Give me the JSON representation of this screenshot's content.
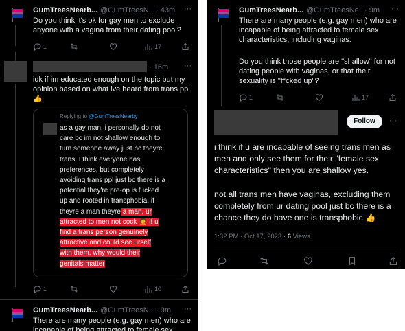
{
  "left": {
    "tweet1": {
      "name": "GumTreesNearb...",
      "handle": "@GumTreesN...",
      "time": "· 43m",
      "more": "···",
      "text": "Do you think it's ok for gay men to exclude anyone with a vagina from their dating pool?",
      "replies": "1",
      "views": "17"
    },
    "tweet2": {
      "time": "· 16m",
      "more": "···",
      "text": "idk if im educated enough on the topic but my opinion based on what ive heard from trans ppl 👍",
      "quote": {
        "replying_prefix": "Replying to ",
        "replying_handle": "@GumTreesNearby",
        "lines_plain": [
          "as a gay man, i personally do not",
          "care bc im not shallow enough to",
          "turn someone away just bc theyre",
          "trans. I think everyone has",
          "preferences, but completely",
          "avoiding trans ppl just bc there is a",
          "potential they're pre-op is fucked",
          "up and rooted in transphobia. if"
        ],
        "line9_plain": "theyre a man theyre",
        "line9_hl": " a man, ur",
        "lines_hl": [
          "attracted to men not cock 🤦 if u",
          "find a trans person genuinely",
          "attractive and could see urself",
          "with them, why would their",
          "genitals matter"
        ]
      },
      "replies": "1",
      "views": "10"
    },
    "tweet3": {
      "name": "GumTreesNearb...",
      "handle": "@GumTreesN...",
      "time": "· 9m",
      "more": "···",
      "text": "There are many people (e.g. gay men) who are incapable of being attracted to female sex"
    }
  },
  "right": {
    "tweet1": {
      "name": "GumTreesNearb...",
      "handle": "@GumTreesNe...",
      "time": "· 9m",
      "more": "···",
      "text1": "There are many people (e.g. gay men) who are incapable of being attracted to female sex characteristics, including vaginas.",
      "text2": "Do you think those people are \"shallow\" for not dating people with vaginas, or that their sexuality is \"f*cked up\"?",
      "replies": "1",
      "views": "17"
    },
    "tweet2": {
      "follow": "Follow",
      "more": "···",
      "text1": "i think if u are incapable of seeing trans men as men and only see them for their \"female sex characteristics\" then you are shallow yes.",
      "text2": "not all trans men have vaginas, excluding them completely from ur dating pool just bc there is a chance they do have one is transphobic 👍",
      "meta_time": "1:32 PM · Oct 17, 2023 · ",
      "meta_views_num": "6",
      "meta_views_label": " Views"
    }
  },
  "colors": {
    "background": "#000000",
    "text": "#e7e9ea",
    "muted": "#71767b",
    "link": "#1d9bf0",
    "highlight": "#e11a2b",
    "redacted": "#3a3a3a"
  },
  "icons": [
    "reply-icon",
    "retweet-icon",
    "like-icon",
    "views-icon",
    "share-icon",
    "more-icon",
    "bi-flag-avatar"
  ]
}
